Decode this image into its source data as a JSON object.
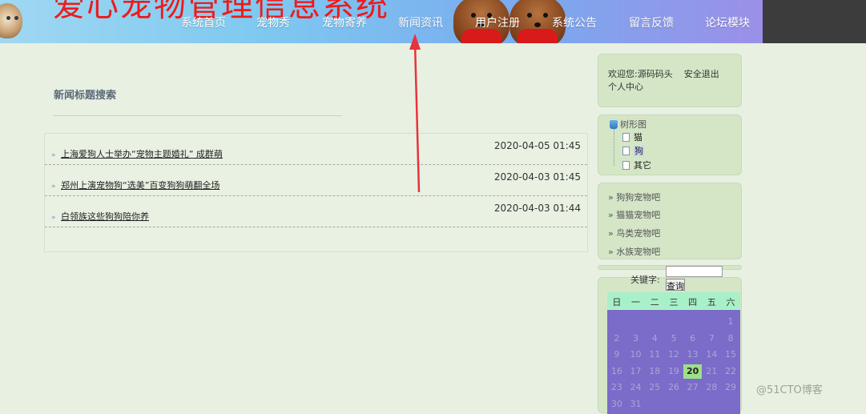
{
  "header": {
    "site_title": "爱心宠物管理信息系统",
    "nav": [
      "系统首页",
      "宠物秀",
      "宠物寄养",
      "新闻资讯",
      "用户注册",
      "系统公告",
      "留言反馈",
      "论坛模块"
    ]
  },
  "search": {
    "title": "新闻标题搜索"
  },
  "news": [
    {
      "title": "上海爱狗人士举办“宠物主题婚礼” 成群萌",
      "date": "2020-04-05 01:45"
    },
    {
      "title": "郑州上演宠物狗“选美”百变狗狗萌翻全场",
      "date": "2020-04-03 01:45"
    },
    {
      "title": "白领族这些狗狗陪你养",
      "date": "2020-04-03 01:44"
    }
  ],
  "sidebar": {
    "welcome_prefix": "欢迎您:",
    "username": "源码码头",
    "logout": "安全退出",
    "profile": "个人中心",
    "tree": {
      "root": "树形图",
      "nodes": [
        "猫",
        "狗",
        "其它"
      ],
      "selected": "狗"
    },
    "forums": [
      "狗狗宠物吧",
      "猫猫宠物吧",
      "鸟类宠物吧",
      "水族宠物吧"
    ],
    "keyword_label": "关键字:",
    "keyword_value": "",
    "query_button": "查询"
  },
  "calendar": {
    "weekdays": [
      "日",
      "一",
      "二",
      "三",
      "四",
      "五",
      "六"
    ],
    "weeks": [
      [
        "",
        "",
        "",
        "",
        "",
        "",
        "1"
      ],
      [
        "2",
        "3",
        "4",
        "5",
        "6",
        "7",
        "8"
      ],
      [
        "9",
        "10",
        "11",
        "12",
        "13",
        "14",
        "15"
      ],
      [
        "16",
        "17",
        "18",
        "19",
        "20",
        "21",
        "22"
      ],
      [
        "23",
        "24",
        "25",
        "26",
        "27",
        "28",
        "29"
      ],
      [
        "30",
        "31",
        "",
        "",
        "",
        "",
        ""
      ]
    ],
    "today": "20"
  },
  "watermark": "@51CTO博客",
  "colors": {
    "annotation_arrow": "#e8323c",
    "calendar_bg": "#7a6cc8",
    "calendar_header": "#a8f0c8",
    "today_bg": "#9de08a"
  }
}
